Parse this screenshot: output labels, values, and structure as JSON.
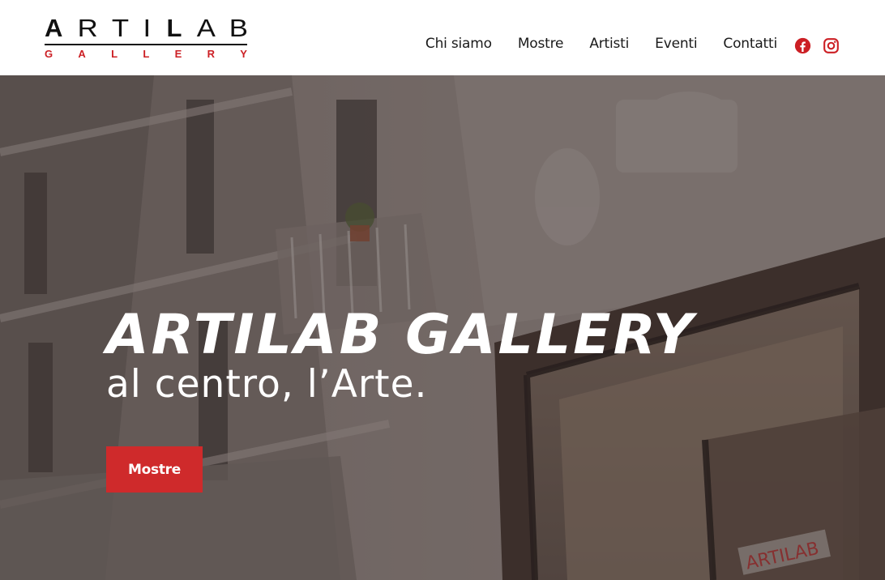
{
  "header": {
    "logo": {
      "top_letters": [
        "A",
        "R",
        "T",
        "I",
        "L",
        "A",
        "B"
      ],
      "bottom_letters": [
        "G",
        "A",
        "L",
        "L",
        "E",
        "R",
        "Y"
      ],
      "accent_color": "#cc1f24"
    },
    "nav": {
      "items": [
        "Chi siamo",
        "Mostre",
        "Artisti",
        "Eventi",
        "Contatti"
      ]
    },
    "social": {
      "icons": [
        "facebook-icon",
        "instagram-icon"
      ],
      "color": "#cc1f24"
    }
  },
  "hero": {
    "title": "ARTILAB GALLERY",
    "subtitle": "al centro, l’Arte.",
    "button_label": "Mostre",
    "button_color": "#cf2a2b",
    "storefront_sign": "ARTILAB"
  }
}
